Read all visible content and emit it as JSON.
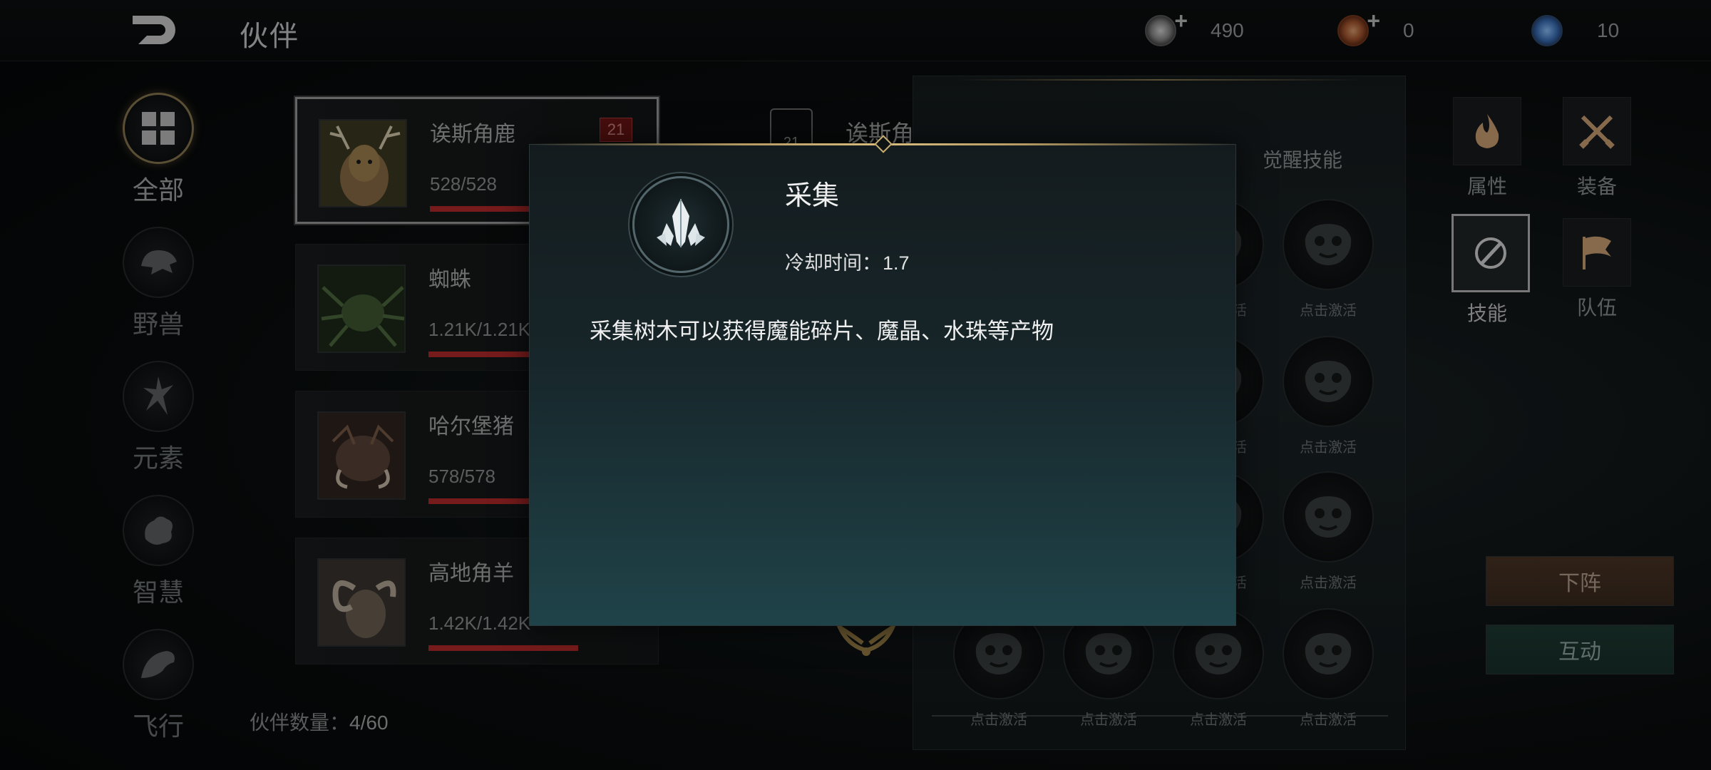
{
  "header": {
    "title": "伙伴",
    "currencies": [
      {
        "icon": "silver-coin-icon",
        "value": "490",
        "has_plus": true
      },
      {
        "icon": "bronze-token-icon",
        "value": "0",
        "has_plus": true
      },
      {
        "icon": "blue-gem-icon",
        "value": "10",
        "has_plus": false
      }
    ]
  },
  "categories": [
    {
      "icon": "grid-icon",
      "label": "全部",
      "active": true
    },
    {
      "icon": "beast-icon",
      "label": "野兽",
      "active": false
    },
    {
      "icon": "element-icon",
      "label": "元素",
      "active": false
    },
    {
      "icon": "wisdom-icon",
      "label": "智慧",
      "active": false
    },
    {
      "icon": "flight-icon",
      "label": "飞行",
      "active": false
    }
  ],
  "companions": [
    {
      "name": "诶斯角鹿",
      "hp": "528/528",
      "level": "21",
      "selected": true,
      "hp_fraction": 1.0
    },
    {
      "name": "蜘蛛",
      "hp": "1.21K/1.21K",
      "selected": false,
      "hp_fraction": 1.0
    },
    {
      "name": "哈尔堡猪",
      "hp": "578/578",
      "selected": false,
      "hp_fraction": 1.0
    },
    {
      "name": "高地角羊",
      "hp": "1.42K/1.42K",
      "selected": false,
      "hp_fraction": 1.0
    }
  ],
  "companion_count": {
    "label": "伙伴数量：",
    "value": "4/60"
  },
  "detail": {
    "name": "诶斯角鹿",
    "level": "21"
  },
  "skill_panel": {
    "tabs": [
      "觉醒技能"
    ],
    "slot_label": "点击激活"
  },
  "side_menu": [
    {
      "icon": "flame-icon",
      "label": "属性",
      "active": false
    },
    {
      "icon": "crossed-swords-icon",
      "label": "装备",
      "active": false
    },
    {
      "icon": "skill-icon",
      "label": "技能",
      "active": true
    },
    {
      "icon": "flag-icon",
      "label": "队伍",
      "active": false
    }
  ],
  "actions": {
    "dismiss": "下阵",
    "interact": "互动"
  },
  "modal": {
    "icon": "crystal-icon",
    "title": "采集",
    "cooldown_label": "冷却时间：",
    "cooldown_value": "1.7",
    "description": "采集树木可以获得魔能碎片、魔晶、水珠等产物"
  }
}
